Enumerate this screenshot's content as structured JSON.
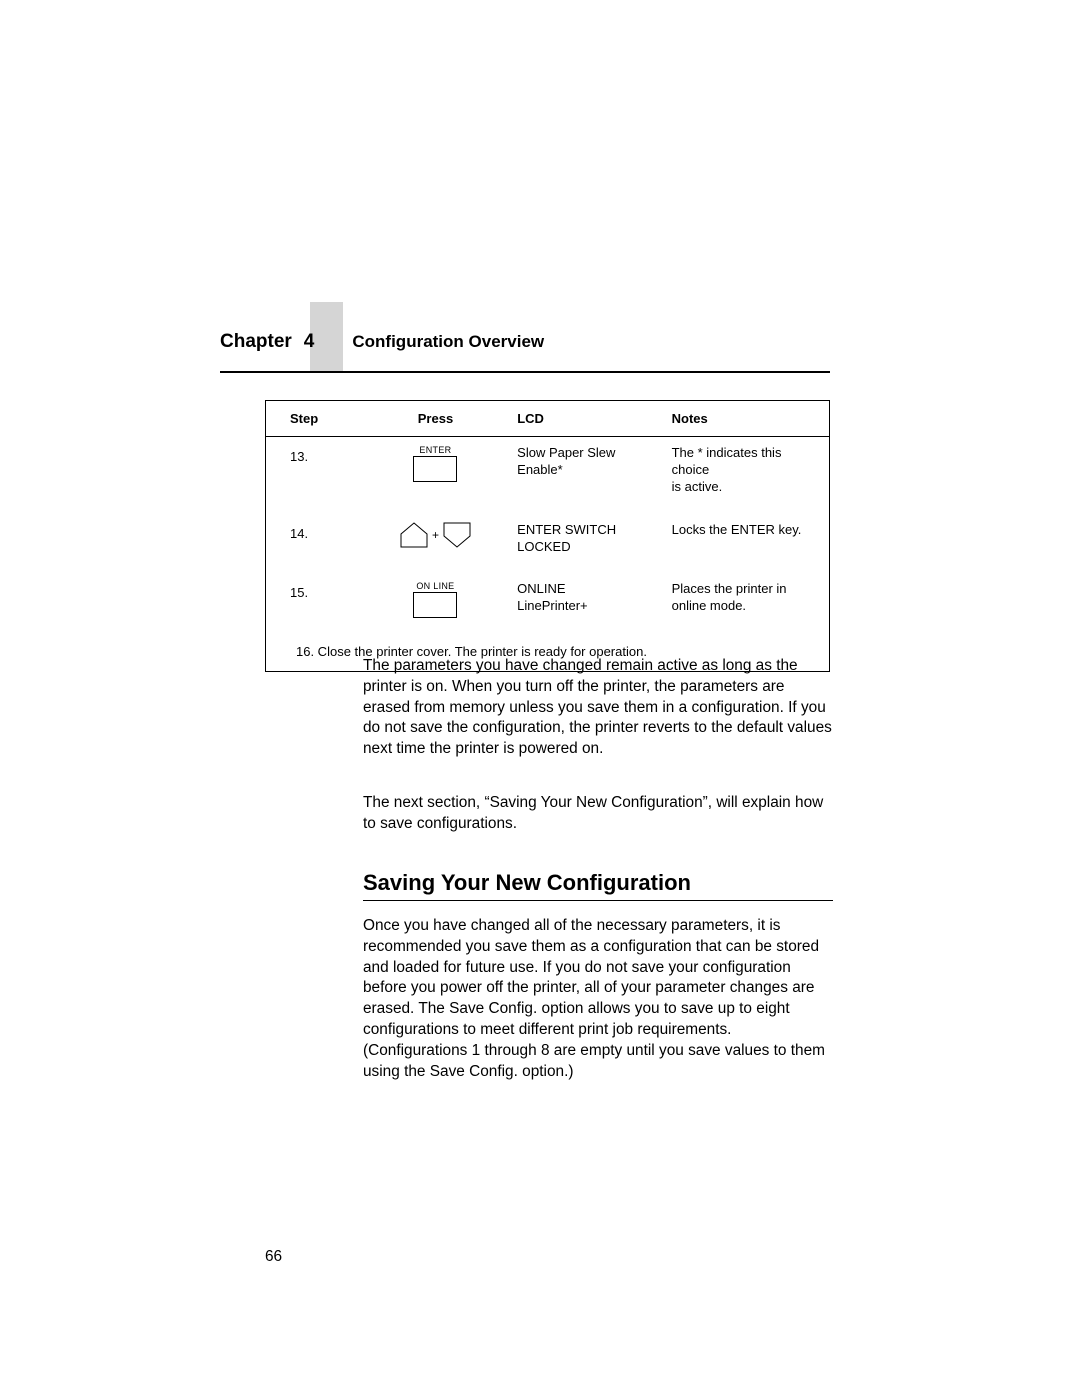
{
  "header": {
    "chapter_label": "Chapter",
    "chapter_number": "4",
    "section_title": "Configuration Overview"
  },
  "table": {
    "headers": {
      "step": "Step",
      "press": "Press",
      "lcd": "LCD",
      "notes": "Notes"
    },
    "rows": [
      {
        "step": "13.",
        "press_type": "single",
        "press_label": "ENTER",
        "lcd_l1": "Slow Paper Slew",
        "lcd_l2": "Enable*",
        "notes_l1": "The * indicates this choice",
        "notes_l2": "is active."
      },
      {
        "step": "14.",
        "press_type": "combo",
        "press_label": "",
        "combo_plus": "+",
        "lcd_l1": "ENTER SWITCH",
        "lcd_l2": "LOCKED",
        "notes_l1": "Locks the ENTER key.",
        "notes_l2": ""
      },
      {
        "step": "15.",
        "press_type": "single",
        "press_label": "ON LINE",
        "lcd_l1": "ONLINE",
        "lcd_l2": "LinePrinter+",
        "notes_l1": "Places the printer in",
        "notes_l2": "online mode."
      }
    ],
    "footer": "16. Close the printer cover. The printer is ready for operation."
  },
  "body": {
    "para1": "The parameters you have changed remain active as long as the printer is on. When you turn off the printer, the parameters are erased from memory unless you save them in a configuration. If you do not save the configuration, the printer reverts to the default values next time the printer is powered on.",
    "para2": "The next section, “Saving Your New Configuration”, will explain how to save configurations.",
    "section_heading": "Saving Your New Configuration",
    "para3": "Once you have changed all of the necessary parameters, it is recommended you save them as a configuration that can be stored and loaded for future use. If you do not save your configuration before you power off the printer, all of your parameter changes are erased. The Save Config. option allows you to save up to eight configurations to meet different print job requirements. (Configurations 1 through 8 are empty until you save values to them using the Save Config. option.)"
  },
  "page_number": "66"
}
